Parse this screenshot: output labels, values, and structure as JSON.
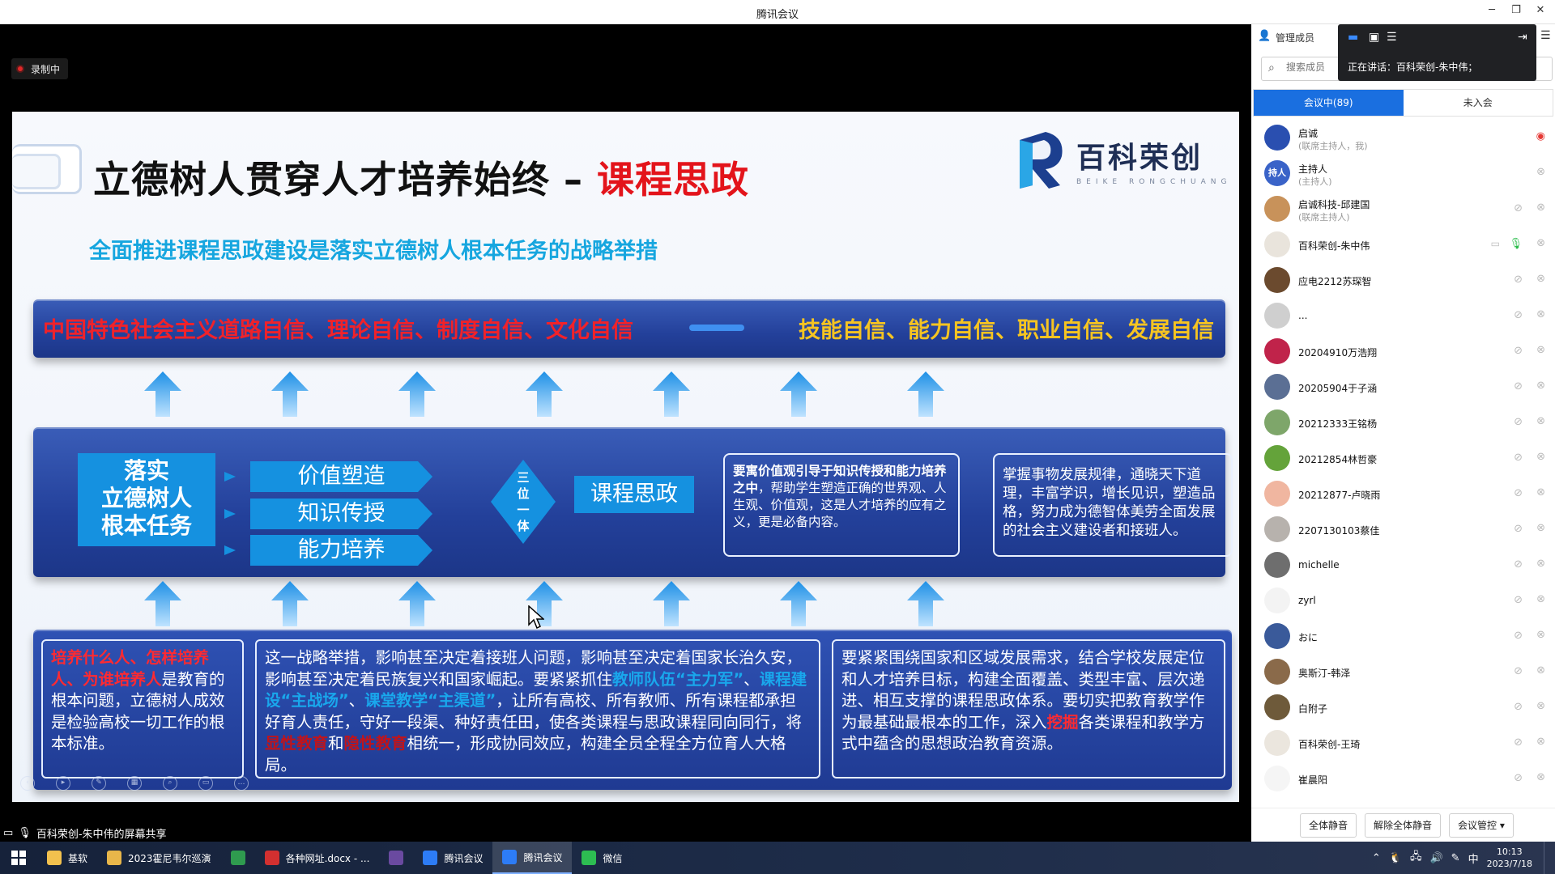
{
  "window": {
    "title": "腾讯会议",
    "minimize": "─",
    "restore": "❐",
    "close": "✕"
  },
  "recording": {
    "label": "录制中"
  },
  "slide": {
    "title_black": "立德树人贯穿人才培养始终 – ",
    "title_red": "课程思政",
    "logo_text": "百科荣创",
    "logo_sub": "BEIKE RONGCHUANG",
    "subtitle": "全面推进课程思政建设是落实立德树人根本任务的战略举措",
    "band1_left": "中国特色社会主义道路自信、理论自信、制度自信、文化自信",
    "band1_right": "技能自信、能力自信、职业自信、发展自信",
    "main_box": [
      "落实",
      "立德树人",
      "根本任务"
    ],
    "pills": [
      "价值塑造",
      "知识传授",
      "能力培养"
    ],
    "diamond": [
      "三",
      "位",
      "一",
      "体"
    ],
    "kc": "课程思政",
    "desc1_bold": "要寓价值观引导于知识传授和能力培养之中",
    "desc1_rest": "，帮助学生塑造正确的世界观、人生观、价值观，这是人才培养的应有之义，更是必备内容。",
    "desc2": "掌握事物发展规律，通晓天下道理，丰富学识，增长见识，塑造品格，努力成为德智体美劳全面发展的社会主义建设者和接班人。",
    "tb1_red": "培养什么人、怎样培养人、为谁培养人",
    "tb1_rest": "是教育的根本问题，立德树人成效是检验高校一切工作的根本标准。",
    "tb2_a": "这一战略举措，影响甚至决定着接班人问题，影响甚至决定着国家长治久安，影响甚至决定着民族复兴和国家崛起。要紧紧抓住",
    "tb2_cyan1": "教师队伍“主力军”",
    "tb2_b": "、",
    "tb2_cyan2": "课程建设“主战场”",
    "tb2_c": "、",
    "tb2_cyan3": "课堂教学“主渠道”",
    "tb2_d": "，让所有高校、所有教师、所有课程都承担好育人责任，守好一段渠、种好责任田，使各类课程与思政课程同向同行，将",
    "tb2_red1": "显性教育",
    "tb2_e": "和",
    "tb2_red2": "隐性教育",
    "tb2_f": "相统一，形成协同效应，构建全员全程全方位育人大格局。",
    "tb3_a": "要紧紧围绕国家和区域发展需求，结合学校发展定位和人才培养目标，构建全面覆盖、类型丰富、层次递进、相互支撑的课程思政体系。要切实把教育教学作为最基础最根本的工作，深入",
    "tb3_red": "挖掘",
    "tb3_b": "各类课程和教学方式中蕴含的思想政治教育资源。"
  },
  "share_status": "百科荣创-朱中伟的屏幕共享",
  "sidebar": {
    "header": "管理成员",
    "search_placeholder": "搜索成员",
    "speaking": "正在讲话：百科荣创-朱中伟；",
    "tabs": [
      "会议中(89)",
      "未入会"
    ],
    "members": [
      {
        "name": "启诚",
        "role": "(联席主持人，我)",
        "avatar": "#2a4fb0",
        "cam_red": true
      },
      {
        "name": "主持人",
        "role": "(主持人)",
        "avatar": "#3a63c8",
        "avatar_text": "持人"
      },
      {
        "name": "启诚科技-邱建国",
        "role": "(联席主持人)",
        "avatar": "#c8925a",
        "mic_off": true
      },
      {
        "name": "百科荣创-朱中伟",
        "role": "",
        "avatar": "#e9e4dc",
        "mic_green": true,
        "screen": true
      },
      {
        "name": "应电2212苏琛智",
        "role": "",
        "avatar": "#6b4a2e",
        "mic_off": true
      },
      {
        "name": "...",
        "role": "",
        "avatar": "#cfcfcf",
        "mic_off": true
      },
      {
        "name": "20204910万浩翔",
        "role": "",
        "avatar": "#c0234a",
        "mic_off": true
      },
      {
        "name": "20205904于子涵",
        "role": "",
        "avatar": "#5b6f94",
        "mic_off": true
      },
      {
        "name": "20212333王铭杨",
        "role": "",
        "avatar": "#7ea66a",
        "mic_off": true
      },
      {
        "name": "20212854林哲豪",
        "role": "",
        "avatar": "#64a33a",
        "mic_off": true
      },
      {
        "name": "20212877-卢晓雨",
        "role": "",
        "avatar": "#f0b6a0",
        "mic_off": true
      },
      {
        "name": "2207130103蔡佳",
        "role": "",
        "avatar": "#b7b2ad",
        "mic_off": true
      },
      {
        "name": "michelle",
        "role": "",
        "avatar": "#6e6e6e",
        "mic_off": true
      },
      {
        "name": "zyrl",
        "role": "",
        "avatar": "#f3f3f3",
        "mic_off": true
      },
      {
        "name": "おに",
        "role": "",
        "avatar": "#3a5a9a",
        "mic_off": true
      },
      {
        "name": "奥斯汀-韩泽",
        "role": "",
        "avatar": "#8a6a4a",
        "mic_off": true
      },
      {
        "name": "白附子",
        "role": "",
        "avatar": "#6e5a3a",
        "mic_off": true
      },
      {
        "name": "百科荣创-王琦",
        "role": "",
        "avatar": "#ebe6de",
        "mic_off": true
      },
      {
        "name": "崔晨阳",
        "role": "",
        "avatar": "#f5f5f5",
        "mic_off": true
      }
    ],
    "buttons": [
      "全体静音",
      "解除全体静音",
      "会议管控 ▾"
    ]
  },
  "taskbar": {
    "items": [
      {
        "label": "基软",
        "color": "#f2c14e"
      },
      {
        "label": "2023霍尼韦尔巡演",
        "color": "#e8b64a"
      },
      {
        "label": "",
        "color": "#2f9b4f"
      },
      {
        "label": "各种网址.docx - ...",
        "color": "#d23030"
      },
      {
        "label": "",
        "color": "#6a4aa0"
      },
      {
        "label": "腾讯会议",
        "color": "#2d7cf6"
      },
      {
        "label": "腾讯会议",
        "color": "#2d7cf6",
        "active": true
      },
      {
        "label": "微信",
        "color": "#2dbd52"
      }
    ],
    "time": "10:13",
    "date": "2023/7/18",
    "ime": "中"
  }
}
